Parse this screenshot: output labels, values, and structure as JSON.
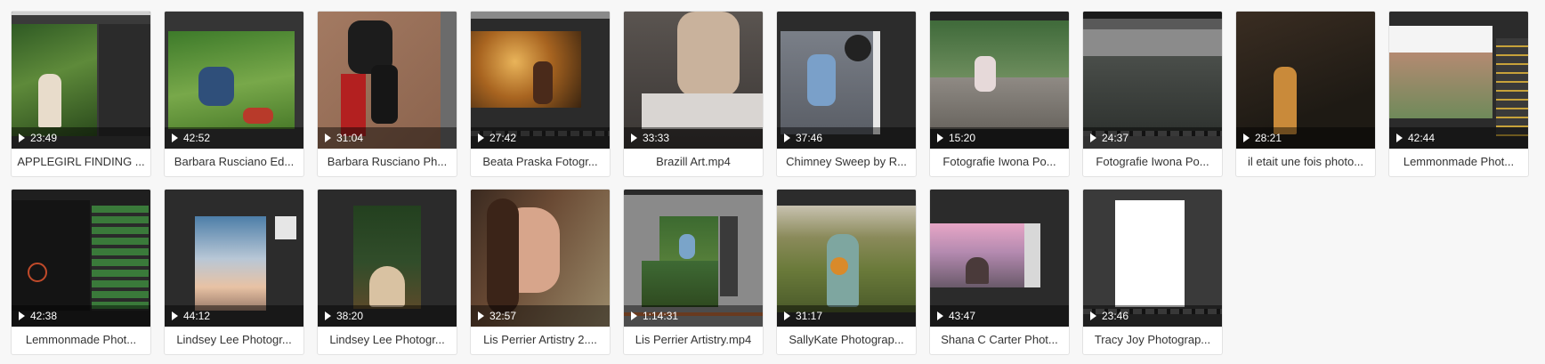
{
  "videos": [
    {
      "name": "APPLEGIRL FINDING ...",
      "duration": "23:49"
    },
    {
      "name": "Barbara Rusciano Ed...",
      "duration": "42:52"
    },
    {
      "name": "Barbara Rusciano Ph...",
      "duration": "31:04"
    },
    {
      "name": "Beata Praska Fotogr...",
      "duration": "27:42"
    },
    {
      "name": "Brazill Art.mp4",
      "duration": "33:33"
    },
    {
      "name": "Chimney Sweep by R...",
      "duration": "37:46"
    },
    {
      "name": "Fotografie Iwona Po...",
      "duration": "15:20"
    },
    {
      "name": "Fotografie Iwona Po...",
      "duration": "24:37"
    },
    {
      "name": "il etait une fois photo...",
      "duration": "28:21"
    },
    {
      "name": "Lemmonmade Phot...",
      "duration": "42:44"
    },
    {
      "name": "Lemmonmade Phot...",
      "duration": "42:38"
    },
    {
      "name": "Lindsey Lee Photogr...",
      "duration": "44:12"
    },
    {
      "name": "Lindsey Lee Photogr...",
      "duration": "38:20"
    },
    {
      "name": "Lis Perrier Artistry 2....",
      "duration": "32:57"
    },
    {
      "name": "Lis Perrier Artistry.mp4",
      "duration": "1:14:31"
    },
    {
      "name": "SallyKate Photograp...",
      "duration": "31:17"
    },
    {
      "name": "Shana C Carter Phot...",
      "duration": "43:47"
    },
    {
      "name": "Tracy Joy Photograp...",
      "duration": "23:46"
    }
  ]
}
